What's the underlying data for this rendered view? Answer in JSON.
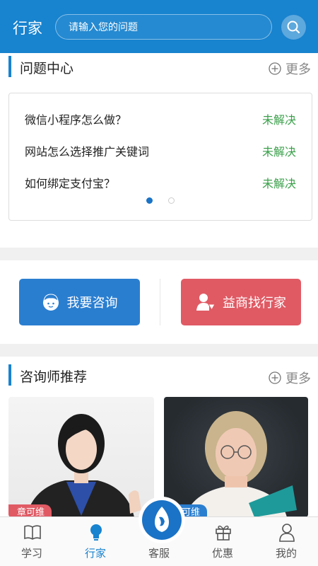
{
  "header": {
    "title": "行家",
    "search_placeholder": "请输入您的问题"
  },
  "question_center": {
    "title": "问题中心",
    "more_label": "更多",
    "questions": [
      {
        "text": "微信小程序怎么做？",
        "status": "未解决"
      },
      {
        "text": "网站怎么选择推广关键词",
        "status": "未解决"
      },
      {
        "text": "如何绑定支付宝？",
        "status": "未解决"
      }
    ],
    "pager": {
      "count": 2,
      "active": 1
    }
  },
  "actions": {
    "consult_label": "我要咨询",
    "find_label": "益商找行家"
  },
  "advisors": {
    "title": "咨询师推荐",
    "more_label": "更多",
    "cards": [
      {
        "name": "章可维",
        "tag_color": "#e05a64"
      },
      {
        "name": "章可维",
        "tag_color": "#2a7ed0"
      }
    ]
  },
  "tabbar": {
    "items": [
      {
        "label": "学习",
        "icon": "book-icon"
      },
      {
        "label": "行家",
        "icon": "bulb-icon",
        "active": true
      },
      {
        "label": "客服",
        "icon": "service-logo-icon"
      },
      {
        "label": "优惠",
        "icon": "gift-icon"
      },
      {
        "label": "我的",
        "icon": "person-icon"
      }
    ]
  },
  "colors": {
    "brand_blue": "#1883cf",
    "status_green": "#3aa04a",
    "find_red": "#e05a64"
  }
}
